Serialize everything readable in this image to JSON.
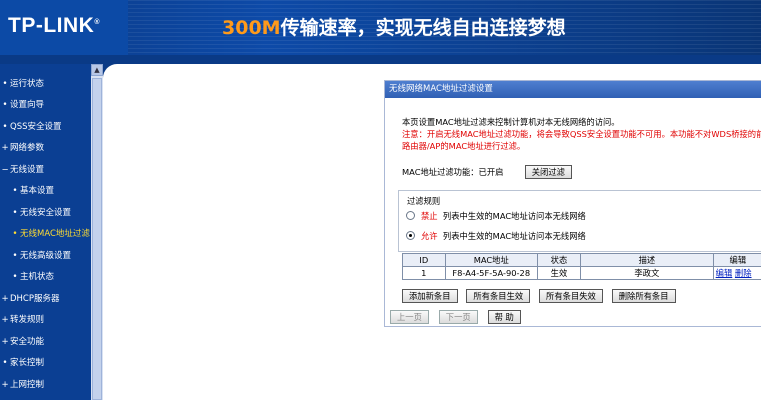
{
  "banner": {
    "logo": "TP-LINK",
    "logo_mark": "®",
    "slogan_accent": "300M",
    "slogan_rest": "传输速率，实现无线自由连接梦想"
  },
  "sidebar": {
    "items": [
      {
        "label": "运行状态",
        "bullet": "•"
      },
      {
        "label": "设置向导",
        "bullet": "•"
      },
      {
        "label": "QSS安全设置",
        "bullet": "•"
      },
      {
        "label": "网络参数",
        "bullet": "+"
      },
      {
        "label": "无线设置",
        "bullet": "−"
      },
      {
        "label": "基本设置",
        "bullet": "•"
      },
      {
        "label": "无线安全设置",
        "bullet": "•"
      },
      {
        "label": "无线MAC地址过滤",
        "bullet": "•"
      },
      {
        "label": "无线高级设置",
        "bullet": "•"
      },
      {
        "label": "主机状态",
        "bullet": "•"
      },
      {
        "label": "DHCP服务器",
        "bullet": "+"
      },
      {
        "label": "转发规则",
        "bullet": "+"
      },
      {
        "label": "安全功能",
        "bullet": "+"
      },
      {
        "label": "家长控制",
        "bullet": "•"
      },
      {
        "label": "上网控制",
        "bullet": "+"
      }
    ],
    "scroll_up": "▲"
  },
  "panel": {
    "title": "无线网络MAC地址过滤设置",
    "desc_line1": "本页设置MAC地址过滤来控制计算机对本无线网络的访问。",
    "desc_line2": "注意：开启无线MAC地址过滤功能，将会导致QSS安全设置功能不可用。本功能不对WDS桥接的前端",
    "desc_line3": "路由器/AP的MAC地址进行过滤。",
    "status_label": "MAC地址过滤功能：已开启",
    "toggle_button": "关闭过滤",
    "rules_title": "过滤规则",
    "rule_deny_kw": "禁止",
    "rule_deny_text": "列表中生效的MAC地址访问本无线网络",
    "rule_allow_kw": "允许",
    "rule_allow_text": "列表中生效的MAC地址访问本无线网络",
    "table_headers": [
      "ID",
      "MAC地址",
      "状态",
      "描述",
      "编辑"
    ],
    "table_rows": [
      {
        "id": "1",
        "mac": "F8-A4-5F-5A-90-28",
        "status": "生效",
        "desc": "李政文",
        "edit": "编辑",
        "delete": "删除"
      }
    ],
    "btn_add": "添加新条目",
    "btn_enable_all": "所有条目生效",
    "btn_disable_all": "所有条目失效",
    "btn_delete_all": "删除所有条目",
    "btn_prev": "上一页",
    "btn_next": "下一页",
    "btn_help": "帮 助"
  }
}
